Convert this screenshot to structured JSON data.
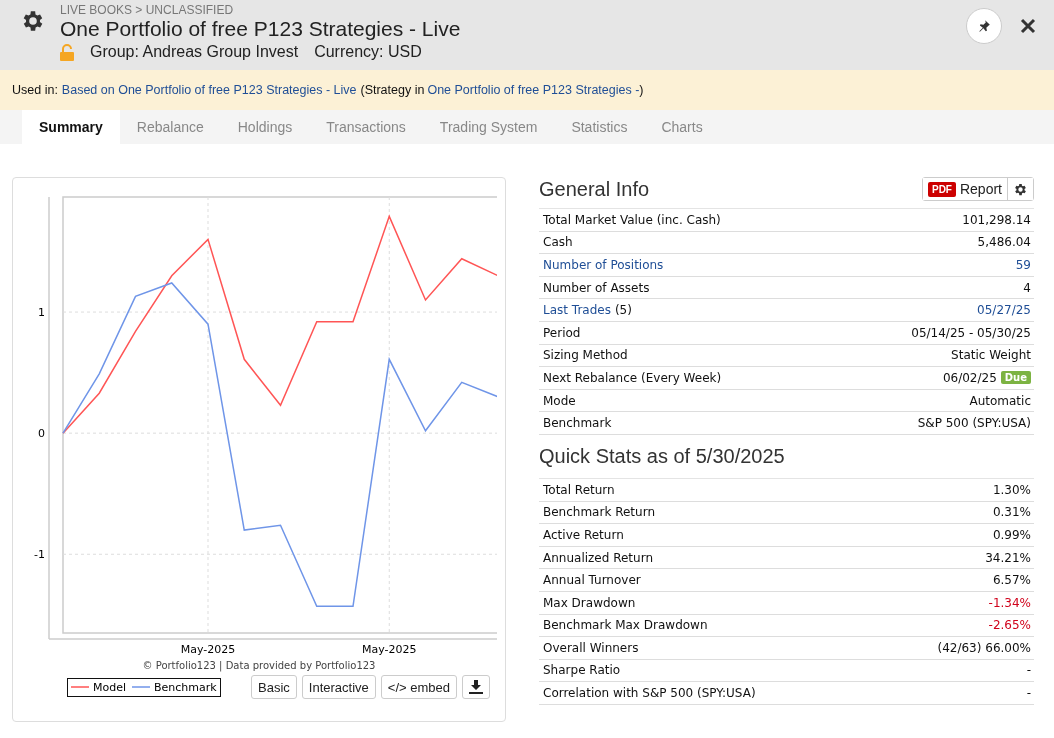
{
  "header": {
    "breadcrumb": "LIVE BOOKS > UNCLASSIFIED",
    "title": "One Portfolio of free P123 Strategies - Live",
    "locked": false,
    "group": "Group: Andreas Group Invest",
    "currency": "Currency: USD"
  },
  "banner": {
    "prefix": "Used in:",
    "link": "Based on One Portfolio of free P123 Strategies - Live",
    "middle": "(Strategy in",
    "link2": "One Portfolio of free P123 Strategies -",
    "suffix": ")"
  },
  "tabs": [
    {
      "label": "Summary",
      "selected": true
    },
    {
      "label": "Rebalance",
      "selected": false
    },
    {
      "label": "Holdings",
      "selected": false
    },
    {
      "label": "Transactions",
      "selected": false
    },
    {
      "label": "Trading System",
      "selected": false
    },
    {
      "label": "Statistics",
      "selected": false
    },
    {
      "label": "Charts",
      "selected": false
    }
  ],
  "chart": {
    "chart_data": {
      "type": "line",
      "grid": true,
      "categories": [
        null,
        null,
        null,
        null,
        "May-2025",
        null,
        null,
        null,
        null,
        "May-2025",
        null,
        null,
        null
      ],
      "ylim": [
        -1.65,
        1.95
      ],
      "yticks": [
        -1,
        0,
        1
      ],
      "series": [
        {
          "name": "Model",
          "color": "#ff5555",
          "values": [
            0,
            0.33,
            0.84,
            1.3,
            1.6,
            0.61,
            0.23,
            0.92,
            0.92,
            1.79,
            1.1,
            1.44,
            1.3
          ]
        },
        {
          "name": "Benchmark",
          "color": "#6f95e8",
          "values": [
            0,
            0.49,
            1.13,
            1.24,
            0.9,
            -0.8,
            -0.76,
            -1.43,
            -1.43,
            0.61,
            0.02,
            0.42,
            0.3
          ]
        }
      ]
    },
    "credit": "© Portfolio123 | Data provided by Portfolio123",
    "buttons": [
      "Basic",
      "Interactive",
      "</> embed"
    ]
  },
  "general_info": {
    "title": "General Info",
    "pdf_badge": "PDF",
    "report": "Report",
    "rows": [
      {
        "label": "Total Market Value (inc. Cash)",
        "value": "101,298.14",
        "kind": "plain"
      },
      {
        "label": "Cash",
        "value": "5,486.04",
        "kind": "plain"
      },
      {
        "label": "Number of Positions",
        "value": "59",
        "kind": "link"
      },
      {
        "label": "Number of Assets",
        "value": "4",
        "kind": "plain"
      },
      {
        "label": "Last Trades",
        "label_suffix": "(5)",
        "value": "05/27/25",
        "kind": "link"
      },
      {
        "label": "Period",
        "value": "05/14/25 - 05/30/25",
        "kind": "plain"
      },
      {
        "label": "Sizing Method",
        "value": "Static Weight",
        "kind": "plain"
      },
      {
        "label": "Next Rebalance (Every Week)",
        "value": "06/02/25",
        "kind": "plain",
        "badge": "Due"
      },
      {
        "label": "Mode",
        "value": "Automatic",
        "kind": "plain"
      },
      {
        "label": "Benchmark",
        "value": "S&P 500 (SPY:USA)",
        "kind": "plain"
      }
    ]
  },
  "quick_stats": {
    "title": "Quick Stats as of 5/30/2025",
    "rows": [
      {
        "label": "Total Return",
        "value": "1.30%",
        "kind": "plain"
      },
      {
        "label": "Benchmark Return",
        "value": "0.31%",
        "kind": "plain"
      },
      {
        "label": "Active Return",
        "value": "0.99%",
        "kind": "plain"
      },
      {
        "label": "Annualized Return",
        "value": "34.21%",
        "kind": "plain"
      },
      {
        "label": "Annual Turnover",
        "value": "6.57%",
        "kind": "plain"
      },
      {
        "label": "Max Drawdown",
        "value": "-1.34%",
        "kind": "negative"
      },
      {
        "label": "Benchmark Max Drawdown",
        "value": "-2.65%",
        "kind": "negative"
      },
      {
        "label": "Overall Winners",
        "value": "(42/63) 66.00%",
        "kind": "plain"
      },
      {
        "label": "Sharpe Ratio",
        "value": "-",
        "kind": "plain"
      },
      {
        "label": "Correlation with S&P 500 (SPY:USA)",
        "value": "-",
        "kind": "plain"
      }
    ]
  }
}
